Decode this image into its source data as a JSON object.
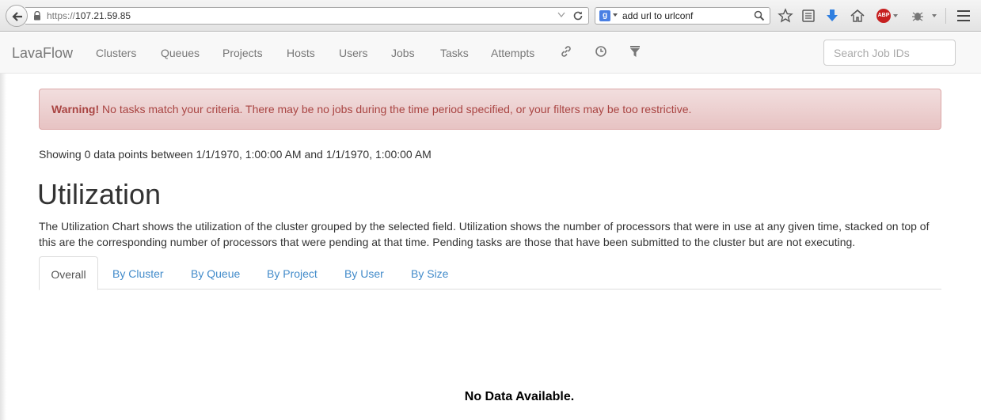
{
  "browser": {
    "url_scheme": "https://",
    "url_host": "107.21.59.85",
    "search_engine_letter": "g",
    "search_text": "add url to urlconf",
    "abp_label": "ABP"
  },
  "navbar": {
    "brand": "LavaFlow",
    "items": [
      "Clusters",
      "Queues",
      "Projects",
      "Hosts",
      "Users",
      "Jobs",
      "Tasks",
      "Attempts"
    ],
    "search_placeholder": "Search Job IDs"
  },
  "alert": {
    "strong": "Warning!",
    "message": " No tasks match your criteria. There may be no jobs during the time period specified, or your filters may be too restrictive."
  },
  "showing_text": "Showing 0 data points between 1/1/1970, 1:00:00 AM and 1/1/1970, 1:00:00 AM",
  "page_title": "Utilization",
  "description": "The Utilization Chart shows the utilization of the cluster grouped by the selected field. Utilization shows the number of processors that were in use at any given time, stacked on top of this are the corresponding number of processors that were pending at that time. Pending tasks are those that have been submitted to the cluster but are not executing.",
  "tabs": [
    "Overall",
    "By Cluster",
    "By Queue",
    "By Project",
    "By User",
    "By Size"
  ],
  "active_tab": "Overall",
  "no_data": "No Data Available."
}
